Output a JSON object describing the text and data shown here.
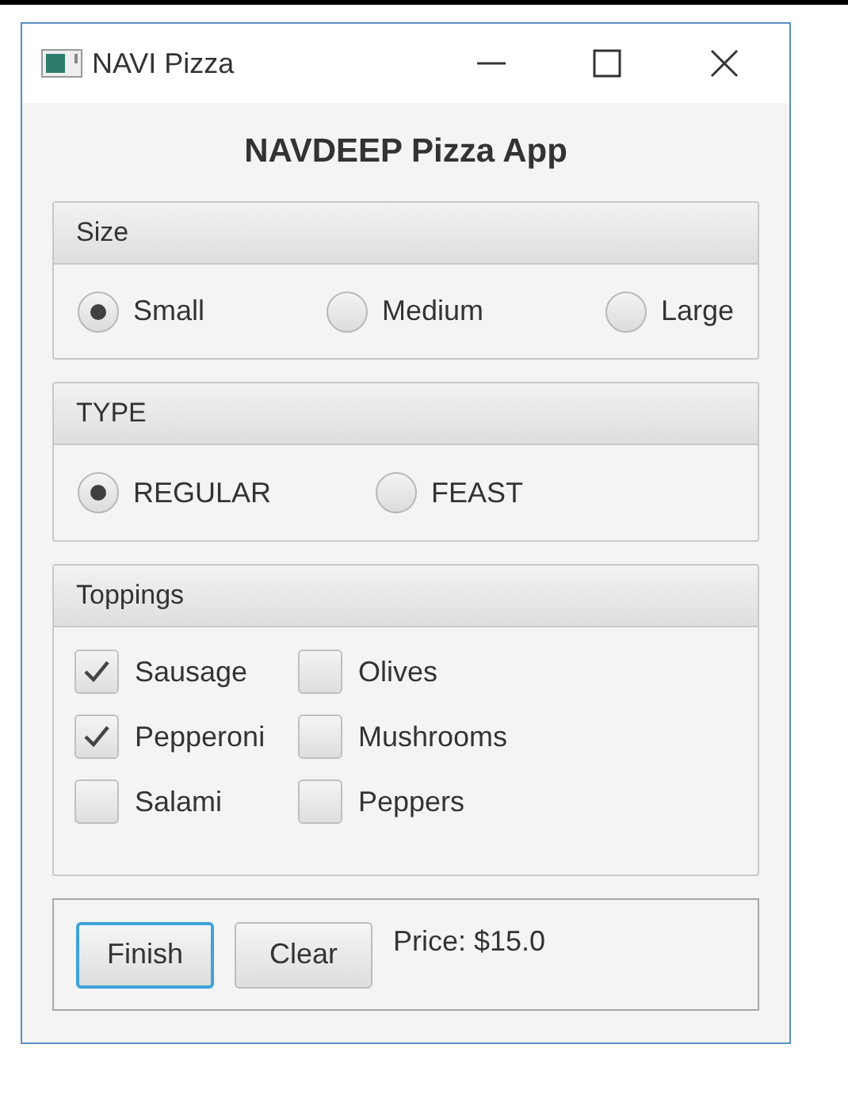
{
  "window": {
    "title": "NAVI Pizza"
  },
  "heading": "NAVDEEP Pizza App",
  "size": {
    "title": "Size",
    "options": [
      {
        "label": "Small",
        "selected": true
      },
      {
        "label": "Medium",
        "selected": false
      },
      {
        "label": "Large",
        "selected": false
      }
    ]
  },
  "type": {
    "title": "TYPE",
    "options": [
      {
        "label": "REGULAR",
        "selected": true
      },
      {
        "label": "FEAST",
        "selected": false
      }
    ]
  },
  "toppings": {
    "title": "Toppings",
    "items": [
      {
        "label": "Sausage",
        "checked": true
      },
      {
        "label": "Olives",
        "checked": false
      },
      {
        "label": "Pepperoni",
        "checked": true
      },
      {
        "label": "Mushrooms",
        "checked": false
      },
      {
        "label": "Salami",
        "checked": false
      },
      {
        "label": "Peppers",
        "checked": false
      }
    ]
  },
  "buttons": [
    {
      "label": "Finish",
      "focused": true
    },
    {
      "label": "Clear",
      "focused": false
    }
  ],
  "price": "Price: $15.0"
}
